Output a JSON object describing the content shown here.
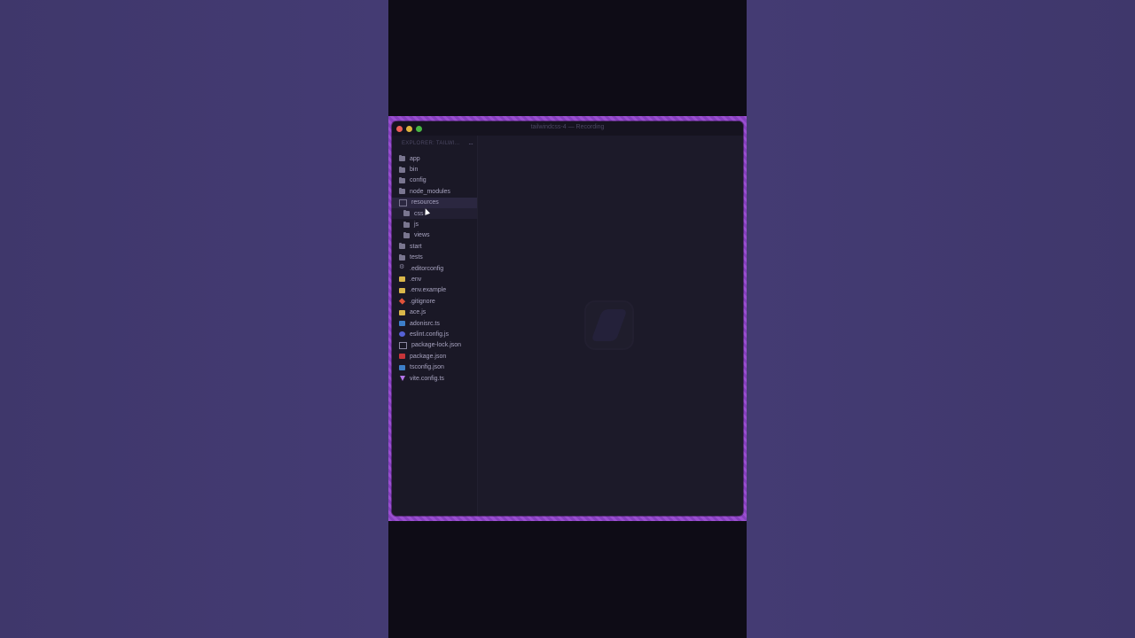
{
  "window": {
    "title": "tailwindcss-4 — Recording"
  },
  "explorer": {
    "title": "EXPLORER: TAILWI...",
    "more_icon": "···"
  },
  "tree": [
    {
      "name": "app",
      "icon": "folder-icon",
      "indent": 0
    },
    {
      "name": "bin",
      "icon": "folder-icon",
      "indent": 0
    },
    {
      "name": "config",
      "icon": "folder-icon",
      "indent": 0
    },
    {
      "name": "node_modules",
      "icon": "folder-icon",
      "indent": 0
    },
    {
      "name": "resources",
      "icon": "folder-open-icon",
      "indent": 0,
      "state": "selected"
    },
    {
      "name": "css",
      "icon": "folder-icon",
      "indent": 1,
      "state": "hover"
    },
    {
      "name": "js",
      "icon": "folder-icon",
      "indent": 1
    },
    {
      "name": "views",
      "icon": "folder-icon",
      "indent": 1
    },
    {
      "name": "start",
      "icon": "folder-icon",
      "indent": 0
    },
    {
      "name": "tests",
      "icon": "folder-icon",
      "indent": 0
    },
    {
      "name": ".editorconfig",
      "icon": "gear-file-icon",
      "indent": 0
    },
    {
      "name": ".env",
      "icon": "env-file-icon",
      "indent": 0
    },
    {
      "name": ".env.example",
      "icon": "env-file-icon",
      "indent": 0
    },
    {
      "name": ".gitignore",
      "icon": "git-file-icon",
      "indent": 0
    },
    {
      "name": "ace.js",
      "icon": "js-file-icon",
      "indent": 0
    },
    {
      "name": "adonisrc.ts",
      "icon": "ts-file-icon",
      "indent": 0
    },
    {
      "name": "eslint.config.js",
      "icon": "eslint-file-icon",
      "indent": 0
    },
    {
      "name": "package-lock.json",
      "icon": "lock-file-icon",
      "indent": 0
    },
    {
      "name": "package.json",
      "icon": "npm-file-icon",
      "indent": 0
    },
    {
      "name": "tsconfig.json",
      "icon": "ts-file-icon",
      "indent": 0
    },
    {
      "name": "vite.config.ts",
      "icon": "vite-file-icon",
      "indent": 0
    }
  ],
  "colors": {
    "background": "#433a72",
    "frame": "#9a4fd0",
    "window": "#1a1826",
    "selected_row": "#2b2740"
  }
}
